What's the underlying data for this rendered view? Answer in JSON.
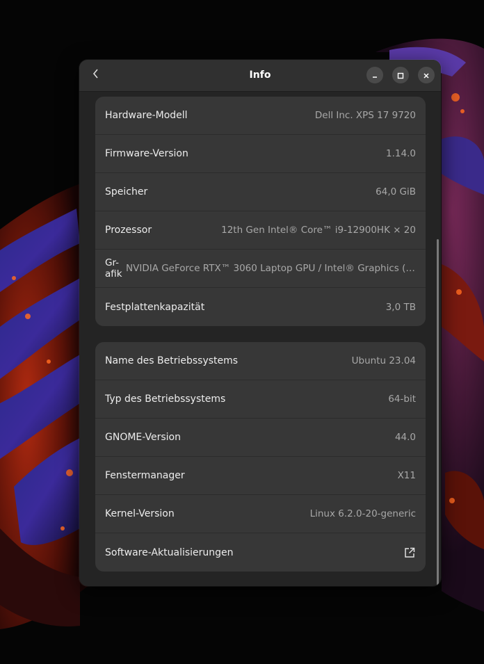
{
  "window": {
    "title": "Info"
  },
  "hardware": [
    {
      "label": "Hardware-Modell",
      "value": "Dell Inc. XPS 17 9720"
    },
    {
      "label": "Firmware-Version",
      "value": "1.14.0"
    },
    {
      "label": "Speicher",
      "value": "64,0 GiB"
    },
    {
      "label": "Prozessor",
      "value": "12th Gen Intel® Core™ i9-12900HK × 20"
    },
    {
      "label": "Gr-afik",
      "value": "NVIDIA GeForce RTX™ 3060 Laptop GPU / Intel® Graphics (A…"
    },
    {
      "label": "Festplattenkapazität",
      "value": "3,0 TB"
    }
  ],
  "system": [
    {
      "label": "Name des Betriebssystems",
      "value": "Ubuntu 23.04"
    },
    {
      "label": "Typ des Betriebssystems",
      "value": "64-bit"
    },
    {
      "label": "GNOME-Version",
      "value": "44.0"
    },
    {
      "label": "Fenstermanager",
      "value": "X11"
    },
    {
      "label": "Kernel-Version",
      "value": "Linux 6.2.0-20-generic"
    },
    {
      "label": "Software-Aktualisierungen"
    }
  ],
  "icons": {
    "back": "chevron-left-icon",
    "minimize": "minimize-icon",
    "maximize": "maximize-icon",
    "close": "close-icon",
    "external": "external-link-icon"
  },
  "colors": {
    "window_bg": "#242424",
    "headerbar_bg": "#303030",
    "group_bg": "#373737",
    "value_text": "#a8a8a8"
  }
}
